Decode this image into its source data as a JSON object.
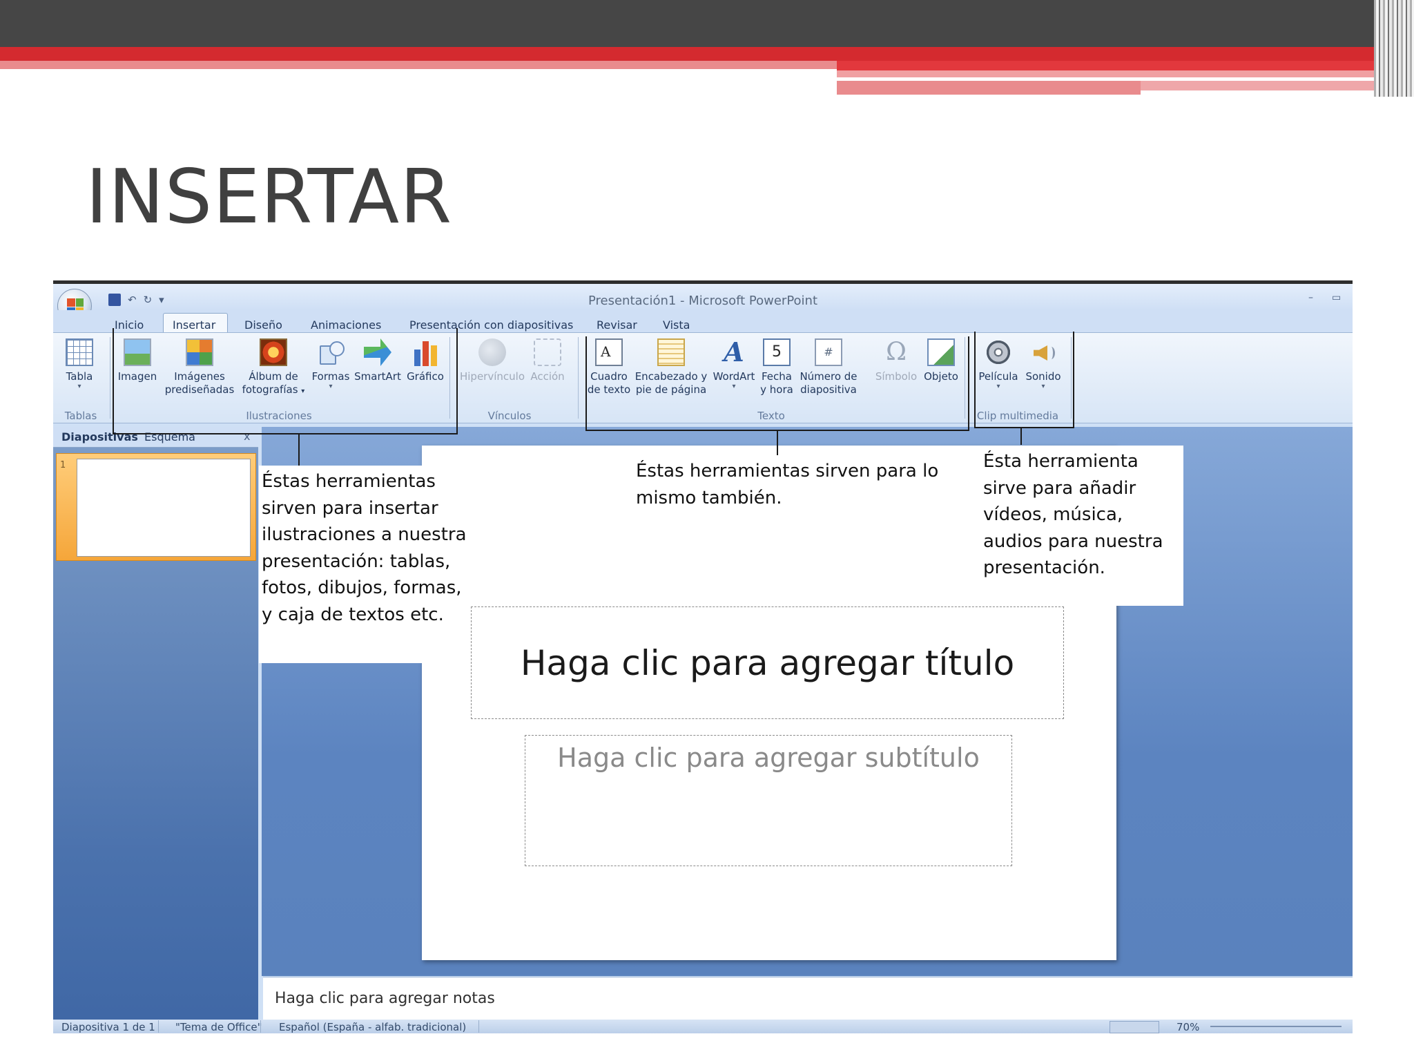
{
  "slide": {
    "title": "INSERTAR"
  },
  "window": {
    "title": "Presentación1 - Microsoft PowerPoint",
    "qat": {
      "undo_glyph": "↶",
      "redo_glyph": "↻",
      "customize_glyph": "▾"
    },
    "controls": {
      "minimize": "–",
      "restore": "▭"
    }
  },
  "tabs": [
    "Inicio",
    "Insertar",
    "Diseño",
    "Animaciones",
    "Presentación con diapositivas",
    "Revisar",
    "Vista"
  ],
  "active_tab": "Insertar",
  "ribbon": {
    "groups": {
      "tablas": "Tablas",
      "ilustraciones": "Ilustraciones",
      "vinculos": "Vínculos",
      "texto": "Texto",
      "clip": "Clip multimedia"
    },
    "tools": {
      "tabla": "Tabla",
      "imagen": "Imagen",
      "imagenes_pred_1": "Imágenes",
      "imagenes_pred_2": "prediseñadas",
      "album_1": "Álbum de",
      "album_2": "fotografías",
      "formas": "Formas",
      "smartart": "SmartArt",
      "grafico": "Gráfico",
      "hipervinculo": "Hipervínculo",
      "accion": "Acción",
      "cuadro_1": "Cuadro",
      "cuadro_2": "de texto",
      "encabezado_1": "Encabezado y",
      "encabezado_2": "pie de página",
      "wordart": "WordArt",
      "fecha_1": "Fecha",
      "fecha_2": "y hora",
      "numero_1": "Número de",
      "numero_2": "diapositiva",
      "simbolo": "Símbolo",
      "objeto": "Objeto",
      "pelicula": "Película",
      "sonido": "Sonido"
    },
    "icon_glyphs": {
      "textbox": "A",
      "date": "5",
      "slidenum": "#",
      "symbol": "Ω",
      "wordart": "A"
    }
  },
  "left_pane": {
    "tab_slides": "Diapositivas",
    "tab_outline": "Esquema",
    "close": "x",
    "thumb_number": "1"
  },
  "slide_canvas": {
    "title_placeholder": "Haga clic para agregar título",
    "subtitle_placeholder": "Haga clic para agregar subtítulo"
  },
  "notes_placeholder": "Haga clic para agregar notas",
  "statusbar": {
    "slide_info": "Diapositiva 1 de 1",
    "theme": "\"Tema de Office\"",
    "language": "Español (España - alfab. tradicional)",
    "zoom": "70%"
  },
  "callouts": {
    "ilustraciones": "Éstas herramientas sirven para insertar ilustraciones a nuestra presentación: tablas, fotos, dibujos, formas, y caja de textos etc.",
    "texto": "Éstas herramientas sirven para lo mismo también.",
    "multimedia": "Ésta herramienta sirve para añadir vídeos, música, audios para nuestra presentación."
  },
  "colors": {
    "band_dark": "#464646",
    "band_red": "#d42a2f",
    "band_pink": "#e98b8d",
    "ribbon_bg": "#d7e5f6",
    "workspace_blue": "#5c84c0"
  }
}
